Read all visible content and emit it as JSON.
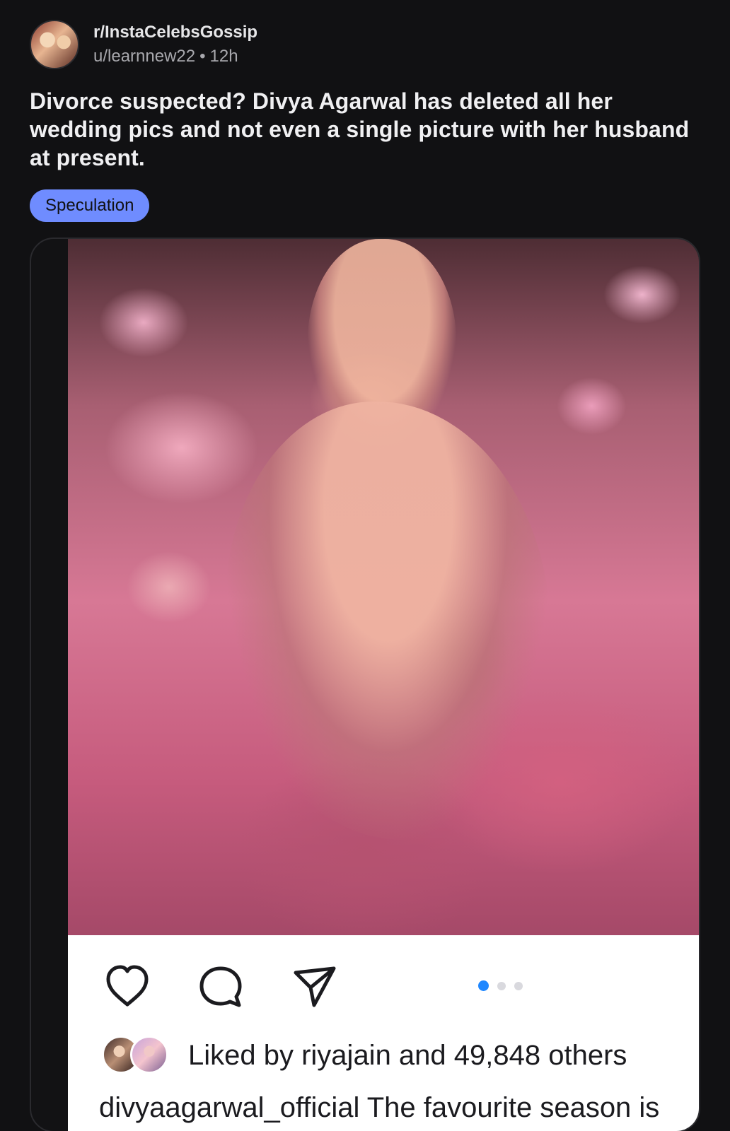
{
  "post": {
    "subreddit": "r/InstaCelebsGossip",
    "user": "u/learnnew22",
    "time": "12h",
    "title": "Divorce suspected? Divya Agarwal has deleted all her wedding pics and not even a single picture with her husband at present.",
    "flair": "Speculation"
  },
  "instagram": {
    "likes_text": "Liked by riyajain and 49,848 others",
    "caption": "divyaagarwal_official The favourite season is",
    "carousel": {
      "current_index": 1,
      "total": 3
    },
    "icons": [
      "heart-icon",
      "comment-icon",
      "share-icon"
    ]
  },
  "colors": {
    "background": "#111113",
    "flair": "#6f8cff",
    "active_dot": "#1f87ff"
  }
}
